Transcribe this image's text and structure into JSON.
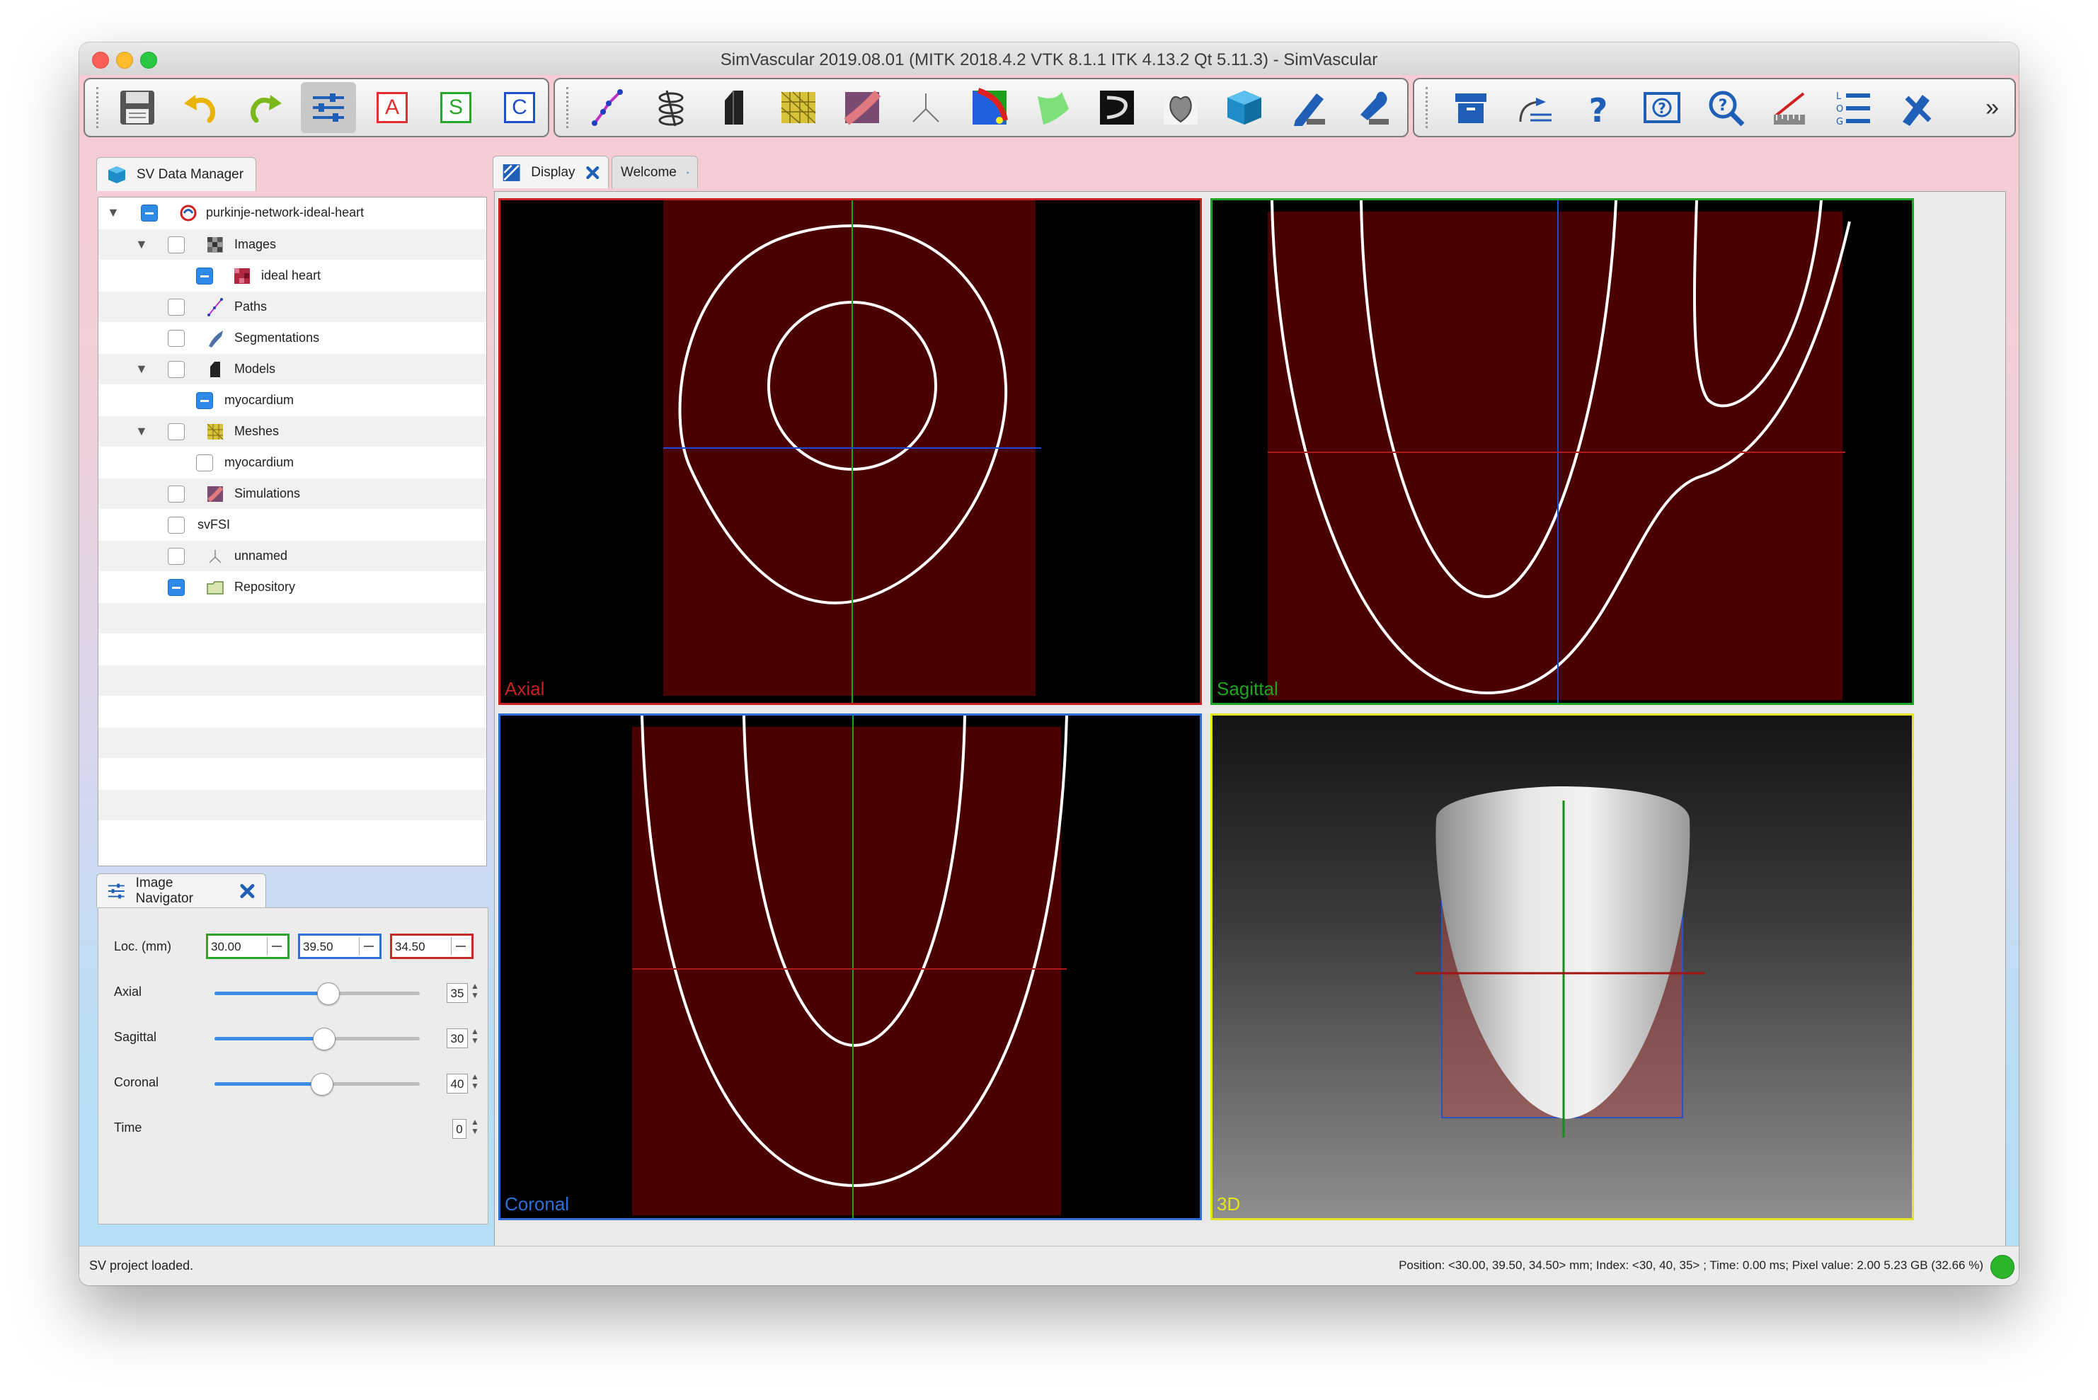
{
  "window": {
    "title": "SimVascular 2019.08.01 (MITK 2018.4.2 VTK 8.1.1 ITK 4.13.2 Qt 5.11.3) - SimVascular"
  },
  "toolbar": {
    "group1": [
      {
        "name": "save-project",
        "icon": "floppy-disk-icon"
      },
      {
        "name": "undo",
        "icon": "undo-arrow-icon"
      },
      {
        "name": "redo",
        "icon": "redo-arrow-icon"
      },
      {
        "name": "image-navigator",
        "icon": "sliders-icon",
        "active": true
      },
      {
        "name": "axial-view",
        "letter": "A",
        "color": "#e03030"
      },
      {
        "name": "sagittal-view",
        "letter": "S",
        "color": "#28a828"
      },
      {
        "name": "coronal-view",
        "letter": "C",
        "color": "#2050c8"
      }
    ],
    "group2_icons": [
      "path-planning-icon",
      "segmentation-icon",
      "modeling-icon",
      "meshing-icon",
      "simulation-icon",
      "purkinje-icon",
      "fsi-icon",
      "ribbon-icon",
      "image-processing-icon",
      "heart-icon",
      "cube-icon",
      "pencil-icon",
      "wrench-icon"
    ],
    "group3_icons": [
      "archive-icon",
      "transform-icon",
      "help-icon",
      "view-help-icon",
      "search-help-icon",
      "measure-icon",
      "log-icon",
      "settings-icon"
    ],
    "more_label": "»"
  },
  "data_manager": {
    "tab_label": "SV Data Manager",
    "items": [
      {
        "label": "purkinje-network-ideal-heart",
        "level": 0,
        "expanded": true,
        "checked": "partial",
        "icon": "project-icon"
      },
      {
        "label": "Images",
        "level": 1,
        "expanded": true,
        "checked": "none",
        "icon": "images-icon"
      },
      {
        "label": "ideal heart",
        "level": 2,
        "checked": "partial",
        "icon": "image-data-icon"
      },
      {
        "label": "Paths",
        "level": 1,
        "checked": "none",
        "icon": "paths-icon"
      },
      {
        "label": "Segmentations",
        "level": 1,
        "checked": "none",
        "icon": "segmentations-icon"
      },
      {
        "label": "Models",
        "level": 1,
        "expanded": true,
        "checked": "none",
        "icon": "models-icon"
      },
      {
        "label": "myocardium",
        "level": 2,
        "checked": "partial",
        "icon": ""
      },
      {
        "label": "Meshes",
        "level": 1,
        "expanded": true,
        "checked": "none",
        "icon": "meshes-icon"
      },
      {
        "label": "myocardium",
        "level": 2,
        "checked": "none",
        "icon": ""
      },
      {
        "label": "Simulations",
        "level": 1,
        "checked": "none",
        "icon": "simulations-icon"
      },
      {
        "label": "svFSI",
        "level": 1,
        "checked": "none",
        "icon": ""
      },
      {
        "label": "unnamed",
        "level": 1,
        "checked": "none",
        "icon": "purkinje-icon"
      },
      {
        "label": "Repository",
        "level": 1,
        "checked": "partial",
        "icon": "repository-icon"
      }
    ]
  },
  "image_navigator": {
    "tab_label": "Image Navigator",
    "loc_label": "Loc. (mm)",
    "loc_values": [
      {
        "value": "30.00",
        "color": "#2aa52a"
      },
      {
        "value": "39.50",
        "color": "#2f6fd6"
      },
      {
        "value": "34.50",
        "color": "#c42a2a"
      }
    ],
    "sliders": [
      {
        "label": "Axial",
        "value": "35",
        "level": 0.55
      },
      {
        "label": "Sagittal",
        "value": "30",
        "level": 0.53
      },
      {
        "label": "Coronal",
        "value": "40",
        "level": 0.52
      }
    ],
    "time_label": "Time",
    "time_value": "0"
  },
  "display_tabs": [
    {
      "label": "Display",
      "active": true
    },
    {
      "label": "Welcome",
      "active": false
    }
  ],
  "views": {
    "axial": {
      "label": "Axial",
      "color": "#c8201e"
    },
    "sagittal": {
      "label": "Sagittal",
      "color": "#1fa51f"
    },
    "coronal": {
      "label": "Coronal",
      "color": "#2c6fd8"
    },
    "threed": {
      "label": "3D",
      "color": "#e5e51f"
    }
  },
  "status": {
    "message": "SV project loaded.",
    "info": "Position: <30.00, 39.50, 34.50> mm; Index: <30, 40, 35> ; Time: 0.00 ms; Pixel value: 2.00   5.23 GB (32.66 %)"
  }
}
